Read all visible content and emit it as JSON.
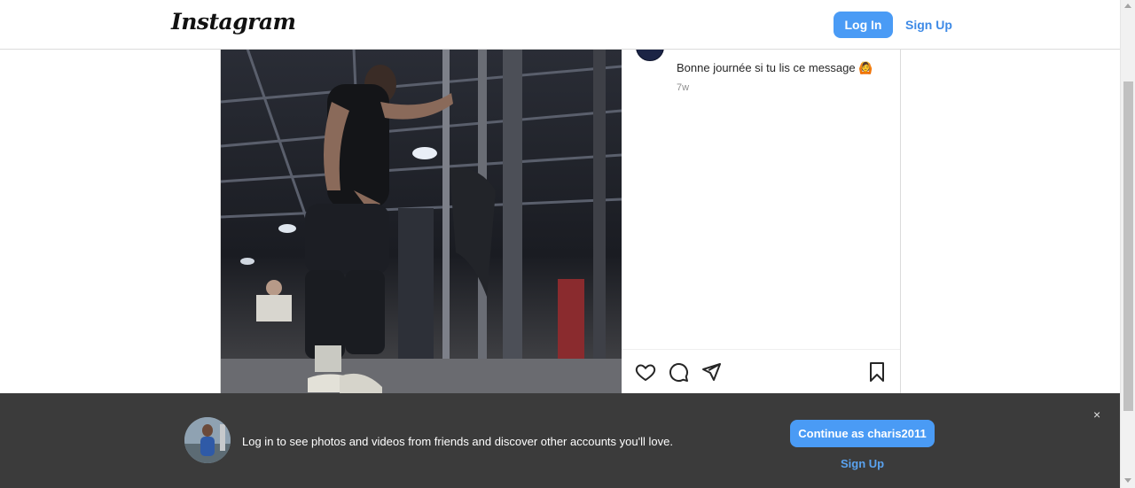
{
  "header": {
    "logo_text": "Instagram",
    "login_label": "Log In",
    "signup_label": "Sign Up"
  },
  "post": {
    "caption": "Bonne journée si tu lis ce message 🙆",
    "time_ago": "7w",
    "actions": {
      "like_icon": "heart-icon",
      "comment_icon": "comment-icon",
      "share_icon": "send-icon",
      "save_icon": "bookmark-icon"
    }
  },
  "banner": {
    "message": "Log in to see photos and videos from friends and discover other accounts you'll love.",
    "continue_label": "Continue as charis2011",
    "signup_label": "Sign Up",
    "close_glyph": "×"
  },
  "colors": {
    "primary_button": "#4a9bf5",
    "link": "#3e8ae6",
    "banner_bg": "#3b3b3b"
  }
}
